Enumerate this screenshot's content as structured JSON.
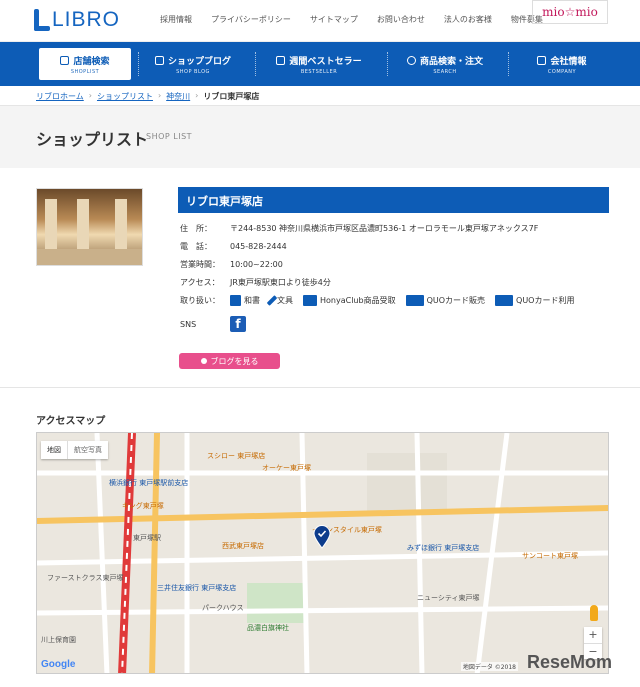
{
  "header": {
    "logo_text": "LIBRO",
    "links": [
      "採用情報",
      "プライバシーポリシー",
      "サイトマップ",
      "お問い合わせ",
      "法人のお客様",
      "物件募集"
    ],
    "partner": "mio☆mio"
  },
  "nav": {
    "items": [
      {
        "label": "店舗検索",
        "sub": "SHOPLIST",
        "icon": "home-icon"
      },
      {
        "label": "ショップブログ",
        "sub": "SHOP BLOG",
        "icon": "pencil-icon"
      },
      {
        "label": "週間ベストセラー",
        "sub": "BESTSELLER",
        "icon": "book-icon"
      },
      {
        "label": "商品検索・注文",
        "sub": "SEARCH",
        "icon": "search-icon"
      },
      {
        "label": "会社情報",
        "sub": "COMPANY",
        "icon": "building-icon"
      }
    ]
  },
  "breadcrumb": [
    "リブロホーム",
    "ショップリスト",
    "神奈川",
    "リブロ東戸塚店"
  ],
  "page": {
    "title": "ショップリスト",
    "title_en": "SHOP LIST"
  },
  "store": {
    "name": "リブロ東戸塚店",
    "address_label": "住　所：",
    "address": "〒244-8530 神奈川県横浜市戸塚区品濃町536-1 オーロラモール東戸塚アネックス7F",
    "tel_label": "電　話：",
    "tel": "045-828-2444",
    "hours_label": "営業時間：",
    "hours": "10:00~22:00",
    "access_label": "アクセス：",
    "access": "JR東戸塚駅東口より徒歩4分",
    "handling_label": "取り扱い：",
    "handling": [
      "和書",
      "文具",
      "HonyaClub商品受取",
      "QUOカード販売",
      "QUOカード利用"
    ],
    "sns_label": "SNS",
    "blog_button": "ブログを見る"
  },
  "access_map": {
    "title": "アクセスマップ",
    "tabs": [
      "地図",
      "航空写真"
    ],
    "labels": {
      "sushiro": "スシロー 東戸塚店",
      "okay": "オーケー東戸塚",
      "seibu": "西武東戸塚店",
      "aeon": "イオンスタイル東戸塚",
      "mizuho": "みずほ銀行 東戸塚支店",
      "yokohama_bank": "横浜銀行 東戸塚駅前支店",
      "smbc": "三井住友銀行 東戸塚支店",
      "sunkus": "サンコート東戸塚",
      "shrine": "品濃白旗神社",
      "parkhouse": "パークハウス",
      "new_city": "ニューシティ東戸塚",
      "kawakami": "川上保育園",
      "mk": "キング東戸塚",
      "kokyo": "東戸塚駅",
      "firstclass": "ファーストクラス東戸塚"
    },
    "map_data_text": "地図データ ©2018",
    "zoom_in": "+",
    "zoom_out": "−",
    "google": "Google"
  },
  "watermark": "ReseMom"
}
